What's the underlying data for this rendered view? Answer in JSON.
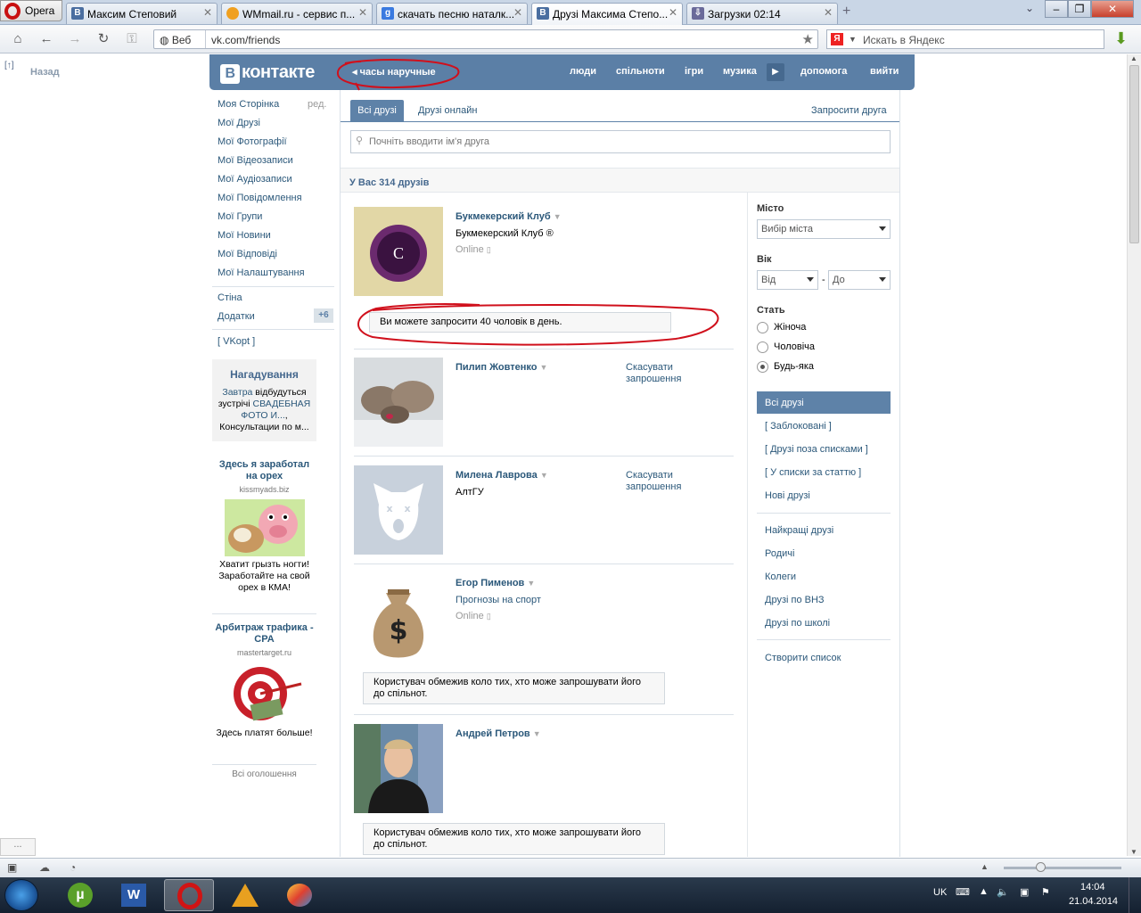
{
  "browser": {
    "name": "Opera",
    "tabs": [
      {
        "title": "Максим Степовий",
        "icon": "vk-icon",
        "active": false
      },
      {
        "title": "WMmail.ru - сервис п...",
        "icon": "wmmail-icon",
        "active": false
      },
      {
        "title": "скачать песню наталк...",
        "icon": "google-icon",
        "active": false
      },
      {
        "title": "Друзі Максима Степо...",
        "icon": "vk-icon",
        "active": true
      },
      {
        "title": "Загрузки 02:14",
        "icon": "downloads-icon",
        "active": false
      }
    ],
    "address": {
      "web_label": "Веб",
      "url": "vk.com/friends"
    },
    "search_placeholder": "Искать в Яндекс"
  },
  "sidebar_back": {
    "arrow": "[↑]",
    "label": "Назад"
  },
  "vk_header": {
    "logo": "контакте",
    "status": "часы наручные",
    "nav": [
      "люди",
      "спільноти",
      "ігри",
      "музика",
      "допомога",
      "вийти"
    ]
  },
  "left_menu": {
    "items": [
      "Моя Сторінка",
      "Мої Друзі",
      "Мої Фотографії",
      "Мої Відеозаписи",
      "Мої Аудіозаписи",
      "Мої Повідомлення",
      "Мої Групи",
      "Мої Новини",
      "Мої Відповіді",
      "Мої Налаштування"
    ],
    "edit": "ред.",
    "extra": [
      "Стіна",
      "Додатки"
    ],
    "apps_badge": "+6",
    "vkopt": "[ VKopt ]"
  },
  "reminder": {
    "title": "Нагадування",
    "line1_link": "Завтра",
    "line1_text": " відбудуться зустрічі ",
    "line1_link2": "СВАДЕБНАЯ ФОТО И...",
    "line2": ", Консультации по м..."
  },
  "ads": [
    {
      "title": "Здесь я заработал на орех",
      "domain": "kissmyads.biz",
      "text": "Хватит грызть ногти! Заработайте на свой орех в КМА!"
    },
    {
      "title": "Арбитраж трафика - CPA",
      "domain": "mastertarget.ru",
      "text": "Здесь платят больше!"
    }
  ],
  "ads_all": "Всі оголошення",
  "friends": {
    "tabs": {
      "all": "Всі друзі",
      "online": "Друзі онлайн",
      "invite": "Запросити друга"
    },
    "search_placeholder": "Почніть вводити ім'я друга",
    "count": "У Вас 314 друзів",
    "list": [
      {
        "name": "Букмекерский Клуб",
        "sub": "Букмекерский Клуб ®",
        "status": "Online"
      },
      {
        "name": "Пилип Жовтенко",
        "action": "Скасувати запрошення"
      },
      {
        "name": "Милена Лаврова",
        "sub": "АлтГУ",
        "action": "Скасувати запрошення"
      },
      {
        "name": "Егор Пименов",
        "sub": "Прогнозы на спорт",
        "status": "Online"
      },
      {
        "name": "Андрей Петров"
      }
    ],
    "notice_invite_limit": "Ви можете запросити 40 чоловік в день.",
    "notice_restricted": "Користувач обмежив коло тих, хто може запрошувати його до спільнот."
  },
  "filters": {
    "city_label": "Місто",
    "city_value": "Вибір міста",
    "age_label": "Вік",
    "age_from": "Від",
    "age_dash": "-",
    "age_to": "До",
    "sex_label": "Стать",
    "sex_options": [
      "Жіноча",
      "Чоловіча",
      "Будь-яка"
    ],
    "sex_selected": "Будь-яка",
    "lists_active": "Всі друзі",
    "lists": [
      "[ Заблоковані ]",
      "[ Друзі поза списками ]",
      "[ У списки за статтю ]",
      "Нові друзі"
    ],
    "groups": [
      "Найкращі друзі",
      "Родичі",
      "Колеги",
      "Друзі по ВНЗ",
      "Друзі по школі"
    ],
    "create": "Створити список"
  },
  "status_bar": {
    "dots": "..."
  },
  "taskbar": {
    "lang": "UK",
    "time": "14:04",
    "date": "21.04.2014"
  },
  "colors": {
    "vk_blue": "#5b7fa6",
    "link": "#2b587a",
    "annotation_red": "#d0101c"
  }
}
